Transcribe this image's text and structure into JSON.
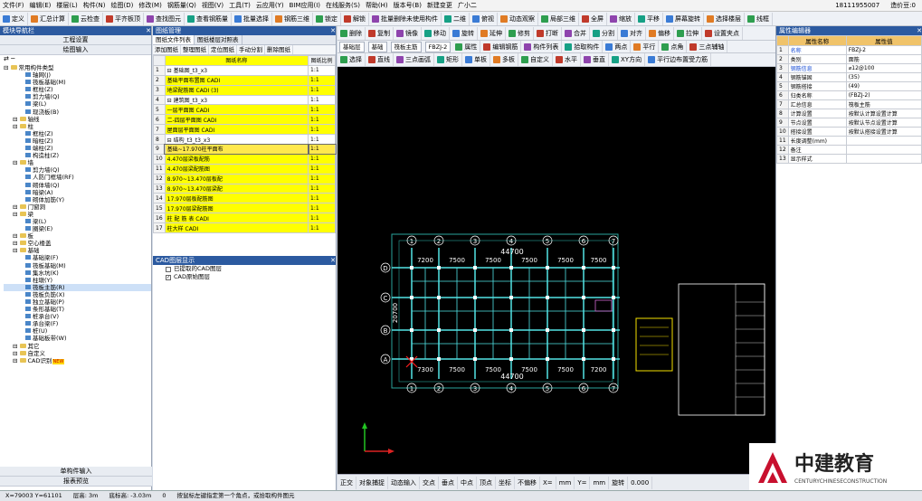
{
  "menubar": {
    "items": [
      "文件(F)",
      "编辑(E)",
      "楼层(L)",
      "构件(N)",
      "绘图(D)",
      "修改(M)",
      "钢筋量(Q)",
      "视图(V)",
      "工具(T)",
      "云应用(Y)",
      "BIM应用(I)",
      "在线服务(S)",
      "帮助(H)",
      "版本号(B)",
      "新建变更",
      "广小二"
    ],
    "phone": "18111955007",
    "price": "造价豆:0"
  },
  "toolbar1": {
    "items": [
      "定义",
      "汇总计算",
      "云检查",
      "平齐板顶",
      "查找图元",
      "查看钢筋量",
      "批量选择",
      "钢筋三维",
      "锁定",
      "解锁",
      "批量删除未使用构件",
      "二维",
      "俯视",
      "动态观察",
      "局部三维",
      "全屏",
      "缩放",
      "平移",
      "屏幕旋转",
      "选择楼层",
      "线框"
    ]
  },
  "nav": {
    "title": "模块导航栏",
    "top_buttons": [
      "工程设置",
      "绘图输入"
    ],
    "tree": [
      {
        "level": 0,
        "text": "常用构件类型",
        "type": "folder"
      },
      {
        "level": 2,
        "text": "轴网(J)",
        "type": "leaf"
      },
      {
        "level": 2,
        "text": "筏板基础(M)",
        "type": "leaf"
      },
      {
        "level": 2,
        "text": "框柱(Z)",
        "type": "leaf"
      },
      {
        "level": 2,
        "text": "剪力墙(Q)",
        "type": "leaf"
      },
      {
        "level": 2,
        "text": "梁(L)",
        "type": "leaf"
      },
      {
        "level": 2,
        "text": "现浇板(B)",
        "type": "leaf"
      },
      {
        "level": 1,
        "text": "轴线",
        "type": "folder"
      },
      {
        "level": 1,
        "text": "柱",
        "type": "folder"
      },
      {
        "level": 2,
        "text": "框柱(Z)",
        "type": "leaf"
      },
      {
        "level": 2,
        "text": "暗柱(Z)",
        "type": "leaf"
      },
      {
        "level": 2,
        "text": "端柱(Z)",
        "type": "leaf"
      },
      {
        "level": 2,
        "text": "构造柱(Z)",
        "type": "leaf"
      },
      {
        "level": 1,
        "text": "墙",
        "type": "folder"
      },
      {
        "level": 2,
        "text": "剪力墙(Q)",
        "type": "leaf"
      },
      {
        "level": 2,
        "text": "人防门框墙(RF)",
        "type": "leaf"
      },
      {
        "level": 2,
        "text": "砌体墙(Q)",
        "type": "leaf"
      },
      {
        "level": 2,
        "text": "暗梁(A)",
        "type": "leaf"
      },
      {
        "level": 2,
        "text": "砌体加筋(Y)",
        "type": "leaf"
      },
      {
        "level": 1,
        "text": "门窗洞",
        "type": "folder"
      },
      {
        "level": 1,
        "text": "梁",
        "type": "folder"
      },
      {
        "level": 2,
        "text": "梁(L)",
        "type": "leaf"
      },
      {
        "level": 2,
        "text": "圈梁(E)",
        "type": "leaf"
      },
      {
        "level": 1,
        "text": "板",
        "type": "folder"
      },
      {
        "level": 1,
        "text": "空心楼盖",
        "type": "folder"
      },
      {
        "level": 1,
        "text": "基础",
        "type": "folder"
      },
      {
        "level": 2,
        "text": "基础梁(F)",
        "type": "leaf"
      },
      {
        "level": 2,
        "text": "筏板基础(M)",
        "type": "leaf"
      },
      {
        "level": 2,
        "text": "集水坑(K)",
        "type": "leaf"
      },
      {
        "level": 2,
        "text": "柱墩(Y)",
        "type": "leaf"
      },
      {
        "level": 2,
        "text": "筏板主筋(R)",
        "type": "leaf",
        "selected": true
      },
      {
        "level": 2,
        "text": "筏板负筋(X)",
        "type": "leaf"
      },
      {
        "level": 2,
        "text": "独立基础(P)",
        "type": "leaf"
      },
      {
        "level": 2,
        "text": "条形基础(T)",
        "type": "leaf"
      },
      {
        "level": 2,
        "text": "桩承台(V)",
        "type": "leaf"
      },
      {
        "level": 2,
        "text": "承台梁(F)",
        "type": "leaf"
      },
      {
        "level": 2,
        "text": "桩(U)",
        "type": "leaf"
      },
      {
        "level": 2,
        "text": "基础板带(W)",
        "type": "leaf"
      },
      {
        "level": 1,
        "text": "其它",
        "type": "folder"
      },
      {
        "level": 1,
        "text": "自定义",
        "type": "folder"
      },
      {
        "level": 1,
        "text": "CAD识别",
        "type": "folder",
        "badge": "NEW"
      }
    ],
    "bottom_buttons": [
      "单构件输入",
      "报表预览"
    ]
  },
  "drawing_mgmt": {
    "title": "图纸管理",
    "tabs": [
      "图纸文件列表",
      "图纸楼层对照表"
    ],
    "buttons": [
      "添加图纸",
      "整理图纸",
      "定位图纸",
      "手动分割",
      "删除图纸"
    ],
    "columns": [
      "图纸名称",
      "图纸比例"
    ],
    "rows": [
      {
        "n": "1",
        "name": "基础图_t3_x3",
        "scale": "1:1",
        "group": true
      },
      {
        "n": "2",
        "name": "基础平面布置图 CADI",
        "scale": "1:1"
      },
      {
        "n": "3",
        "name": "地梁配筋图 CADI (3)",
        "scale": "1:1"
      },
      {
        "n": "4",
        "name": "建筑图_t3_x3",
        "scale": "1:1",
        "group": true
      },
      {
        "n": "5",
        "name": "一层平面图 CADI",
        "scale": "1:1"
      },
      {
        "n": "6",
        "name": "二-四层平面图 CADI",
        "scale": "1:1"
      },
      {
        "n": "7",
        "name": "屋面层平面图 CADI",
        "scale": "1:1"
      },
      {
        "n": "8",
        "name": "结构_t3_t3_x3",
        "scale": "1:1",
        "group": true
      },
      {
        "n": "9",
        "name": "基础~17.970柱平面布",
        "scale": "1:1",
        "selected": true
      },
      {
        "n": "10",
        "name": "4.470层梁板配筋",
        "scale": "1:1"
      },
      {
        "n": "11",
        "name": "4.470层梁配筋图",
        "scale": "1:1"
      },
      {
        "n": "12",
        "name": "8.970~13.470层板配",
        "scale": "1:1"
      },
      {
        "n": "13",
        "name": "8.970~13.470层梁配",
        "scale": "1:1"
      },
      {
        "n": "14",
        "name": "17.970层板配筋图",
        "scale": "1:1"
      },
      {
        "n": "15",
        "name": "17.970层梁配筋图",
        "scale": "1:1"
      },
      {
        "n": "16",
        "name": "柱 配 筋 表 CADI",
        "scale": "1:1"
      },
      {
        "n": "17",
        "name": "柱大样 CADI",
        "scale": "1:1"
      }
    ]
  },
  "cad_layers": {
    "title": "CAD图层显示",
    "items": [
      {
        "label": "已提取的CAD图层",
        "checked": false
      },
      {
        "label": "CAD原始图层",
        "checked": true
      }
    ]
  },
  "drawing_toolbar": {
    "row1": [
      "删除",
      "复制",
      "镜像",
      "移动",
      "旋转",
      "延伸",
      "修剪",
      "打断",
      "合并",
      "分割",
      "对齐",
      "偏移",
      "拉伸",
      "设置夹点"
    ],
    "row2": {
      "floor": "基础层",
      "category": "基础",
      "type": "筏板主筋",
      "item": "FBZJ-2",
      "buttons": [
        "属性",
        "编辑钢筋",
        "构件列表",
        "拾取构件",
        "两点",
        "平行",
        "点角",
        "三点辅轴"
      ]
    },
    "row3": [
      "选择",
      "直线",
      "三点画弧",
      "矩形",
      "单板",
      "多板",
      "自定义",
      "水平",
      "垂直",
      "XY方向",
      "平行边布置受力筋"
    ]
  },
  "drawing": {
    "total_width": "44700",
    "spans": [
      "7200",
      "7500",
      "7500",
      "7500",
      "7500",
      "7500"
    ],
    "spans_bottom": [
      "7300",
      "7500",
      "7500",
      "7500",
      "7500",
      "7200"
    ],
    "col_labels": [
      "1",
      "2",
      "3",
      "4",
      "5",
      "6",
      "7"
    ],
    "row_labels": [
      "D",
      "C",
      "B",
      "A"
    ],
    "left_dim": "20700"
  },
  "snap_bar": [
    "正交",
    "对象捕捉",
    "动态输入",
    "交点",
    "垂点",
    "中点",
    "顶点",
    "坐标",
    "不偏移",
    "X=",
    "mm",
    "Y=",
    "mm",
    "旋转",
    "0.000"
  ],
  "properties": {
    "title": "属性编辑器",
    "columns": [
      "属性名称",
      "属性值"
    ],
    "rows": [
      {
        "n": "1",
        "name": "名称",
        "value": "FBZJ-2",
        "blue": true
      },
      {
        "n": "2",
        "name": "类别",
        "value": "面筋"
      },
      {
        "n": "3",
        "name": "钢筋信息",
        "value": "⌀12@100",
        "blue": true
      },
      {
        "n": "4",
        "name": "钢筋锚固",
        "value": "(35)"
      },
      {
        "n": "5",
        "name": "钢筋搭接",
        "value": "(49)"
      },
      {
        "n": "6",
        "name": "归类名称",
        "value": "(FBZJ-2)"
      },
      {
        "n": "7",
        "name": "汇总信息",
        "value": "筏板主筋"
      },
      {
        "n": "8",
        "name": "计算设置",
        "value": "按默认计算设置计算"
      },
      {
        "n": "9",
        "name": "节点设置",
        "value": "按默认节点设置计算"
      },
      {
        "n": "10",
        "name": "搭接设置",
        "value": "按默认搭接设置计算"
      },
      {
        "n": "11",
        "name": "长度调整(mm)",
        "value": ""
      },
      {
        "n": "12",
        "name": "备注",
        "value": ""
      },
      {
        "n": "13",
        "name": "显示样式",
        "value": ""
      }
    ]
  },
  "statusbar": {
    "coords": "X=79003 Y=61101",
    "floor_height": "层高: 3m",
    "base_elev": "底标高: -3.03m",
    "zero": "0",
    "hint": "按鼠标左键指定第一个角点，或拾取构件图元"
  },
  "logo": {
    "cn": "中建教育",
    "en": "CENTURYCHINESECONSTRUCTION"
  },
  "colors": {
    "title_bar": "#2c5aa0",
    "highlight": "#ffff00",
    "canvas": "#000000",
    "grid": "#52e4e6",
    "header": "#f0c36a"
  }
}
